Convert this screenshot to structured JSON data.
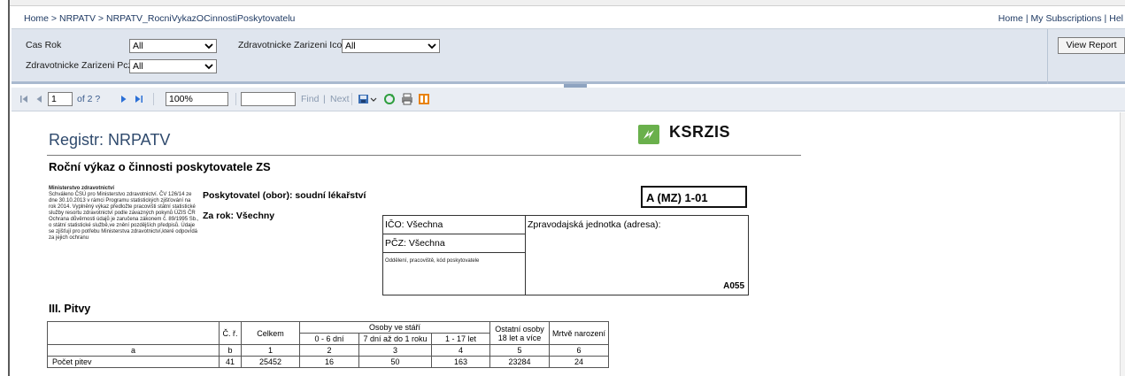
{
  "breadcrumb": {
    "items": [
      "Home",
      "NRPATV",
      "NRPATV_RocniVykazOCinnostiPoskytovatelu"
    ],
    "separator": " > "
  },
  "toplinks": [
    "Home",
    "My Subscriptions",
    "Hel"
  ],
  "params": {
    "cas_rok": {
      "label": "Cas Rok",
      "value": "All"
    },
    "zz_ico": {
      "label": "Zdravotnicke Zarizeni Ico",
      "value": "All"
    },
    "zz_pcz": {
      "label": "Zdravotnicke Zarizeni Pcz",
      "value": "All"
    },
    "view_report_label": "View Report"
  },
  "toolbar": {
    "page": "1",
    "of_pages": "of 2 ?",
    "zoom": "100%",
    "find_label": "Find",
    "separator": "|",
    "next_label": "Next"
  },
  "report": {
    "title": "Registr: NRPATV",
    "logo_text": "KSRZIS",
    "subtitle": "Roční výkaz o činnosti poskytovatele ZS",
    "ministry_title": "Ministerstvo zdravotnictví",
    "ministry_text": "Schváleno ČSÚ pro Ministerstvo zdravotnictví. ČV 126/14 ze dne 30.10.2013 v rámci Programu statistických zjišťování na rok 2014. Vyplněný výkaz předložte pracovišti státní statistické služby resortu zdravotnictví podle závazných pokynů ÚZIS ČR Ochrana důvěrnosti údajů je zaručena zákonem č. 89/1995 Sb., o státní statistické službě,ve znění pozdějších předpisů. Údaje se zjišťují pro potřebu Ministerstva zdravotnictví,které odpovídá za jejich ochranu",
    "provider": "Poskytovatel (obor): soudní lékařství",
    "year": "Za rok: Všechny",
    "form_code": "A (MZ) 1-01",
    "ico": "IČO: Všechna",
    "pcz": "PČZ: Všechna",
    "dept": "Oddělení, pracoviště, kód poskytovatele",
    "reporting_unit": "Zpravodajská jednotka (adresa):",
    "unit_code": "A055",
    "section": "III. Pitvy"
  },
  "table": {
    "headers": {
      "cr": "Č. ř.",
      "total": "Celkem",
      "age_group": "Osoby ve stáří",
      "age_0_6": "0 - 6 dní",
      "age_7_1": "7 dní až do 1 roku",
      "age_1_17": "1 - 17 let",
      "other": "Ostatní osoby 18 let a více",
      "stillborn": "Mrtvě narození"
    },
    "codes": [
      "a",
      "b",
      "1",
      "2",
      "3",
      "4",
      "5",
      "6"
    ],
    "rows": [
      {
        "label": "Počet pitev",
        "cr": "41",
        "total": "25452",
        "c2": "16",
        "c3": "50",
        "c4": "163",
        "c5": "23284",
        "c6": "24"
      }
    ]
  }
}
